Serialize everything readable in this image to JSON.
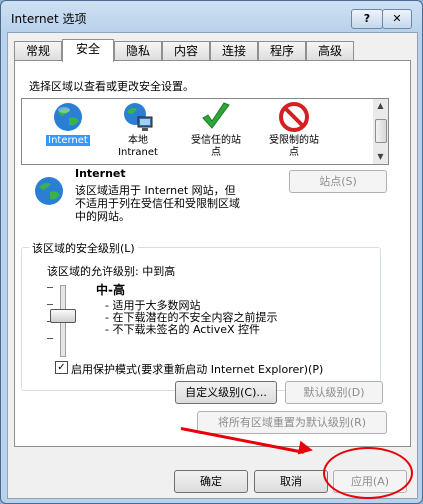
{
  "window": {
    "title": "Internet 选项",
    "help_label": "?",
    "close_label": "✕"
  },
  "tabs": [
    {
      "label": "常规",
      "active": false
    },
    {
      "label": "安全",
      "active": true
    },
    {
      "label": "隐私",
      "active": false
    },
    {
      "label": "内容",
      "active": false
    },
    {
      "label": "连接",
      "active": false
    },
    {
      "label": "程序",
      "active": false
    },
    {
      "label": "高级",
      "active": false
    }
  ],
  "security": {
    "select_zone_prompt": "选择区域以查看或更改安全设置。",
    "zones": [
      {
        "label": "Internet",
        "icon": "globe-icon",
        "selected": true
      },
      {
        "label": "本地\nIntranet",
        "icon": "intranet-icon",
        "selected": false
      },
      {
        "label": "受信任的站\n点",
        "icon": "check-icon",
        "selected": false
      },
      {
        "label": "受限制的站\n点",
        "icon": "restricted-icon",
        "selected": false
      }
    ],
    "zone_title": "Internet",
    "zone_description": "该区域适用于 Internet 网站，但\n不适用于列在受信任和受限制区域\n中的网站。",
    "sites_button": "站点(S)",
    "level_group_label": "该区域的安全级别(L)",
    "allowed_levels": "该区域的允许级别: 中到高",
    "level_name": "中-高",
    "level_bullets": [
      "- 适用于大多数网站",
      "- 在下载潜在的不安全内容之前提示",
      "- 不下载未签名的 ActiveX 控件"
    ],
    "protected_mode_label": "启用保护模式(要求重新启动 Internet Explorer)(P)",
    "protected_mode_checked": true,
    "custom_level_button": "自定义级别(C)...",
    "default_level_button": "默认级别(D)",
    "reset_all_button": "将所有区域重置为默认级别(R)"
  },
  "footer": {
    "ok_button": "确定",
    "cancel_button": "取消",
    "apply_button": "应用(A)"
  },
  "colors": {
    "annotation_red": "#e8000a",
    "selection_blue": "#3399ff"
  }
}
